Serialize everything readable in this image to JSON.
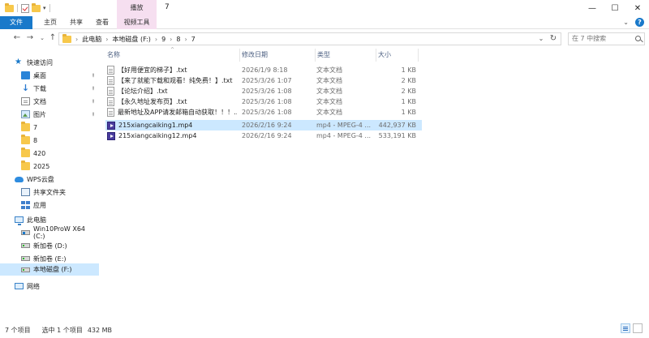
{
  "window": {
    "title": "7",
    "minimize": "—",
    "maximize": "☐",
    "close": "✕",
    "context_tab_group": "播放"
  },
  "ribbon": {
    "tabs": [
      {
        "label": "文件"
      },
      {
        "label": "主页"
      },
      {
        "label": "共享"
      },
      {
        "label": "查看"
      },
      {
        "label": "视频工具"
      }
    ]
  },
  "address": {
    "crumbs": [
      "此电脑",
      "本地磁盘 (F:)",
      "9",
      "8",
      "7"
    ],
    "search_placeholder": "在 7 中搜索"
  },
  "sidebar": {
    "items": [
      {
        "label": "快速访问",
        "icon": "star-icon"
      },
      {
        "label": "桌面",
        "icon": "desktop-icon",
        "pinned": true
      },
      {
        "label": "下载",
        "icon": "download-icon",
        "pinned": true
      },
      {
        "label": "文档",
        "icon": "document-icon",
        "pinned": true
      },
      {
        "label": "图片",
        "icon": "picture-icon",
        "pinned": true
      },
      {
        "label": "7",
        "icon": "folder-icon"
      },
      {
        "label": "8",
        "icon": "folder-icon"
      },
      {
        "label": "420",
        "icon": "folder-icon"
      },
      {
        "label": "2025",
        "icon": "folder-icon"
      },
      {
        "label": "WPS云盘",
        "icon": "cloud-icon"
      },
      {
        "label": "共享文件夹",
        "icon": "shared-folder-icon"
      },
      {
        "label": "应用",
        "icon": "apps-icon"
      },
      {
        "label": "此电脑",
        "icon": "computer-icon"
      },
      {
        "label": "Win10ProW X64 (C:)",
        "icon": "drive-icon"
      },
      {
        "label": "新加卷 (D:)",
        "icon": "drive-icon"
      },
      {
        "label": "新加卷 (E:)",
        "icon": "drive-icon"
      },
      {
        "label": "本地磁盘 (F:)",
        "icon": "drive-icon",
        "selected": true
      },
      {
        "label": "网络",
        "icon": "network-icon"
      }
    ]
  },
  "columns": {
    "name": "名称",
    "date": "修改日期",
    "type": "类型",
    "size": "大小"
  },
  "files": [
    {
      "name": "【好用便宜的梯子】.txt",
      "date": "2026/1/9 8:18",
      "type": "文本文档",
      "size": "1 KB",
      "kind": "txt"
    },
    {
      "name": "【来了就能下载和观看！纯免费！】.txt",
      "date": "2025/3/26 1:07",
      "type": "文本文档",
      "size": "2 KB",
      "kind": "txt"
    },
    {
      "name": "【论坛介绍】.txt",
      "date": "2025/3/26 1:08",
      "type": "文本文档",
      "size": "2 KB",
      "kind": "txt"
    },
    {
      "name": "【永久地址发布页】.txt",
      "date": "2025/3/26 1:08",
      "type": "文本文档",
      "size": "1 KB",
      "kind": "txt"
    },
    {
      "name": "最新地址及APP请发邮箱自动获取！！！...",
      "date": "2025/3/26 1:08",
      "type": "文本文档",
      "size": "1 KB",
      "kind": "txt"
    },
    {
      "name": "215xiangcaiking1.mp4",
      "date": "2026/2/16 9:24",
      "type": "mp4 - MPEG-4 ...",
      "size": "442,937 KB",
      "kind": "mp4",
      "selected": true
    },
    {
      "name": "215xiangcaiking12.mp4",
      "date": "2026/2/16 9:24",
      "type": "mp4 - MPEG-4 ...",
      "size": "533,191 KB",
      "kind": "mp4"
    }
  ],
  "status": {
    "count": "7 个项目",
    "selected": "选中 1 个项目",
    "selected_size": "432 MB"
  },
  "colors": {
    "accent": "#1979ca",
    "selection": "#cce8ff",
    "context_tab": "#f6dff0"
  }
}
